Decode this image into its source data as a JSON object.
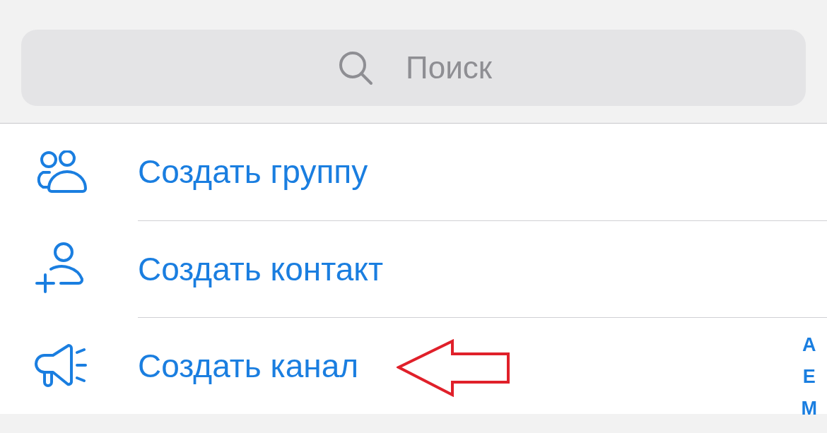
{
  "search": {
    "placeholder": "Поиск"
  },
  "actions": [
    {
      "label": "Создать группу"
    },
    {
      "label": "Создать контакт"
    },
    {
      "label": "Создать канал"
    }
  ],
  "index_letters": [
    "A",
    "E",
    "M"
  ]
}
